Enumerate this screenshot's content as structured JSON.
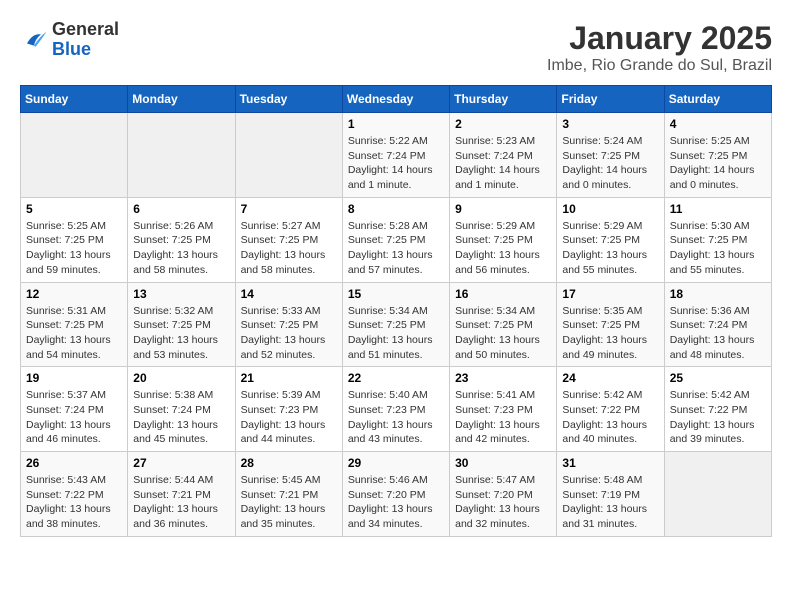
{
  "logo": {
    "general": "General",
    "blue": "Blue"
  },
  "title": "January 2025",
  "subtitle": "Imbe, Rio Grande do Sul, Brazil",
  "days_of_week": [
    "Sunday",
    "Monday",
    "Tuesday",
    "Wednesday",
    "Thursday",
    "Friday",
    "Saturday"
  ],
  "weeks": [
    [
      {
        "day": "",
        "info": ""
      },
      {
        "day": "",
        "info": ""
      },
      {
        "day": "",
        "info": ""
      },
      {
        "day": "1",
        "info": "Sunrise: 5:22 AM\nSunset: 7:24 PM\nDaylight: 14 hours\nand 1 minute."
      },
      {
        "day": "2",
        "info": "Sunrise: 5:23 AM\nSunset: 7:24 PM\nDaylight: 14 hours\nand 1 minute."
      },
      {
        "day": "3",
        "info": "Sunrise: 5:24 AM\nSunset: 7:25 PM\nDaylight: 14 hours\nand 0 minutes."
      },
      {
        "day": "4",
        "info": "Sunrise: 5:25 AM\nSunset: 7:25 PM\nDaylight: 14 hours\nand 0 minutes."
      }
    ],
    [
      {
        "day": "5",
        "info": "Sunrise: 5:25 AM\nSunset: 7:25 PM\nDaylight: 13 hours\nand 59 minutes."
      },
      {
        "day": "6",
        "info": "Sunrise: 5:26 AM\nSunset: 7:25 PM\nDaylight: 13 hours\nand 58 minutes."
      },
      {
        "day": "7",
        "info": "Sunrise: 5:27 AM\nSunset: 7:25 PM\nDaylight: 13 hours\nand 58 minutes."
      },
      {
        "day": "8",
        "info": "Sunrise: 5:28 AM\nSunset: 7:25 PM\nDaylight: 13 hours\nand 57 minutes."
      },
      {
        "day": "9",
        "info": "Sunrise: 5:29 AM\nSunset: 7:25 PM\nDaylight: 13 hours\nand 56 minutes."
      },
      {
        "day": "10",
        "info": "Sunrise: 5:29 AM\nSunset: 7:25 PM\nDaylight: 13 hours\nand 55 minutes."
      },
      {
        "day": "11",
        "info": "Sunrise: 5:30 AM\nSunset: 7:25 PM\nDaylight: 13 hours\nand 55 minutes."
      }
    ],
    [
      {
        "day": "12",
        "info": "Sunrise: 5:31 AM\nSunset: 7:25 PM\nDaylight: 13 hours\nand 54 minutes."
      },
      {
        "day": "13",
        "info": "Sunrise: 5:32 AM\nSunset: 7:25 PM\nDaylight: 13 hours\nand 53 minutes."
      },
      {
        "day": "14",
        "info": "Sunrise: 5:33 AM\nSunset: 7:25 PM\nDaylight: 13 hours\nand 52 minutes."
      },
      {
        "day": "15",
        "info": "Sunrise: 5:34 AM\nSunset: 7:25 PM\nDaylight: 13 hours\nand 51 minutes."
      },
      {
        "day": "16",
        "info": "Sunrise: 5:34 AM\nSunset: 7:25 PM\nDaylight: 13 hours\nand 50 minutes."
      },
      {
        "day": "17",
        "info": "Sunrise: 5:35 AM\nSunset: 7:25 PM\nDaylight: 13 hours\nand 49 minutes."
      },
      {
        "day": "18",
        "info": "Sunrise: 5:36 AM\nSunset: 7:24 PM\nDaylight: 13 hours\nand 48 minutes."
      }
    ],
    [
      {
        "day": "19",
        "info": "Sunrise: 5:37 AM\nSunset: 7:24 PM\nDaylight: 13 hours\nand 46 minutes."
      },
      {
        "day": "20",
        "info": "Sunrise: 5:38 AM\nSunset: 7:24 PM\nDaylight: 13 hours\nand 45 minutes."
      },
      {
        "day": "21",
        "info": "Sunrise: 5:39 AM\nSunset: 7:23 PM\nDaylight: 13 hours\nand 44 minutes."
      },
      {
        "day": "22",
        "info": "Sunrise: 5:40 AM\nSunset: 7:23 PM\nDaylight: 13 hours\nand 43 minutes."
      },
      {
        "day": "23",
        "info": "Sunrise: 5:41 AM\nSunset: 7:23 PM\nDaylight: 13 hours\nand 42 minutes."
      },
      {
        "day": "24",
        "info": "Sunrise: 5:42 AM\nSunset: 7:22 PM\nDaylight: 13 hours\nand 40 minutes."
      },
      {
        "day": "25",
        "info": "Sunrise: 5:42 AM\nSunset: 7:22 PM\nDaylight: 13 hours\nand 39 minutes."
      }
    ],
    [
      {
        "day": "26",
        "info": "Sunrise: 5:43 AM\nSunset: 7:22 PM\nDaylight: 13 hours\nand 38 minutes."
      },
      {
        "day": "27",
        "info": "Sunrise: 5:44 AM\nSunset: 7:21 PM\nDaylight: 13 hours\nand 36 minutes."
      },
      {
        "day": "28",
        "info": "Sunrise: 5:45 AM\nSunset: 7:21 PM\nDaylight: 13 hours\nand 35 minutes."
      },
      {
        "day": "29",
        "info": "Sunrise: 5:46 AM\nSunset: 7:20 PM\nDaylight: 13 hours\nand 34 minutes."
      },
      {
        "day": "30",
        "info": "Sunrise: 5:47 AM\nSunset: 7:20 PM\nDaylight: 13 hours\nand 32 minutes."
      },
      {
        "day": "31",
        "info": "Sunrise: 5:48 AM\nSunset: 7:19 PM\nDaylight: 13 hours\nand 31 minutes."
      },
      {
        "day": "",
        "info": ""
      }
    ]
  ]
}
